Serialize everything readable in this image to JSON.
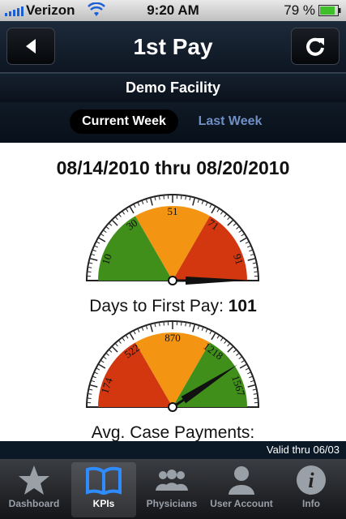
{
  "status": {
    "carrier": "Verizon",
    "time": "9:20 AM",
    "battery": "79 %"
  },
  "nav": {
    "title": "1st Pay"
  },
  "facility": "Demo Facility",
  "weeks": {
    "current": "Current Week",
    "last": "Last Week"
  },
  "date_range": "08/14/2010 thru 08/20/2010",
  "gauges": [
    {
      "ticks": [
        "10",
        "30",
        "51",
        "71",
        "91"
      ],
      "label": "Days to First Pay: ",
      "value": "101",
      "needle": 101
    },
    {
      "ticks": [
        "174",
        "522",
        "870",
        "1218",
        "1567"
      ],
      "label": "Avg. Case Payments:",
      "value": "",
      "needle": 1420
    }
  ],
  "valid": "Valid thru 06/03",
  "tabs": [
    {
      "label": "Dashboard",
      "icon": "star-icon"
    },
    {
      "label": "KPIs",
      "icon": "book-icon"
    },
    {
      "label": "Physicians",
      "icon": "group-icon"
    },
    {
      "label": "User Account",
      "icon": "user-icon"
    },
    {
      "label": "Info",
      "icon": "info-icon"
    }
  ],
  "colors": {
    "green": "#3f8f1a",
    "orange": "#f39412",
    "red": "#d2370f"
  }
}
